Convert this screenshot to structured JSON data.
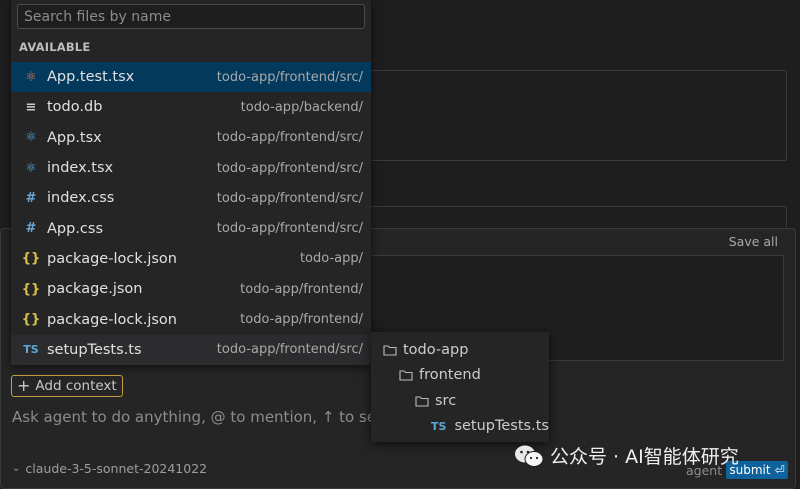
{
  "background": {
    "save_all_label": "Save all"
  },
  "chat": {
    "add_context_label": "Add context",
    "input_placeholder": "Ask agent to do anything, @ to mention, ↑ to selec",
    "model_name": "claude-3-5-sonnet-20241022",
    "mode_label": "agent",
    "submit_label": "submit",
    "submit_icon": "return-icon"
  },
  "file_picker": {
    "search_placeholder": "Search files by name",
    "section_header": "AVAILABLE",
    "files": [
      {
        "name": "App.test.tsx",
        "path": "todo-app/frontend/src/",
        "icon": "react-icon",
        "selected": true
      },
      {
        "name": "todo.db",
        "path": "todo-app/backend/",
        "icon": "database-file-icon"
      },
      {
        "name": "App.tsx",
        "path": "todo-app/frontend/src/",
        "icon": "react-icon"
      },
      {
        "name": "index.tsx",
        "path": "todo-app/frontend/src/",
        "icon": "react-icon"
      },
      {
        "name": "index.css",
        "path": "todo-app/frontend/src/",
        "icon": "css-hash-icon"
      },
      {
        "name": "App.css",
        "path": "todo-app/frontend/src/",
        "icon": "css-hash-icon"
      },
      {
        "name": "package-lock.json",
        "path": "todo-app/",
        "icon": "json-braces-icon"
      },
      {
        "name": "package.json",
        "path": "todo-app/frontend/",
        "icon": "json-braces-icon"
      },
      {
        "name": "package-lock.json",
        "path": "todo-app/frontend/",
        "icon": "json-braces-icon"
      },
      {
        "name": "setupTests.ts",
        "path": "todo-app/frontend/src/",
        "icon": "typescript-icon",
        "hovered": true
      }
    ]
  },
  "tree_popup": {
    "items": [
      {
        "label": "todo-app",
        "type": "folder"
      },
      {
        "label": "frontend",
        "type": "folder"
      },
      {
        "label": "src",
        "type": "folder"
      },
      {
        "label": "setupTests.ts",
        "type": "file"
      }
    ]
  },
  "watermark": {
    "text": "公众号 · AI智能体研究"
  },
  "colors": {
    "selected_row": "#04395e",
    "accent_gold": "#c29d41",
    "submit_blue": "#0e639c"
  }
}
